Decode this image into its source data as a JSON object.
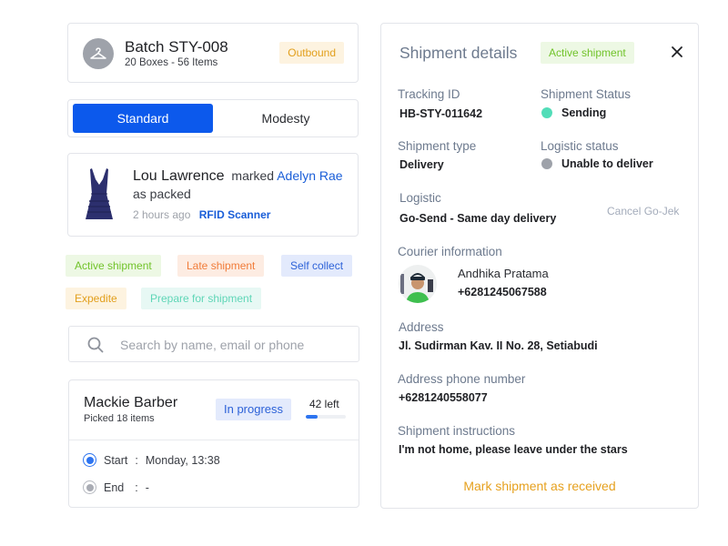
{
  "batch": {
    "icon": "hanger-icon",
    "title": "Batch STY-008",
    "subtitle": "20 Boxes - 56 Items",
    "badge": "Outbound"
  },
  "segmented": {
    "options": [
      "Standard",
      "Modesty"
    ],
    "selected": "Standard"
  },
  "activity": {
    "image": "dress-image",
    "actor": "Lou Lawrence",
    "verb": "marked",
    "target": "Adelyn Rae",
    "result": "as packed",
    "time": "2 hours ago",
    "source": "RFID Scanner"
  },
  "tags": [
    {
      "label": "Active shipment",
      "color": "#71c32a",
      "bg": "#edf8e4"
    },
    {
      "label": "Late shipment",
      "color": "#f17c39",
      "bg": "#fdece2"
    },
    {
      "label": "Self collect",
      "color": "#2d62d8",
      "bg": "#e3eafc"
    },
    {
      "label": "Expedite",
      "color": "#e29f1c",
      "bg": "#fdf3e0"
    },
    {
      "label": "Prepare for shipment",
      "color": "#5fd6b7",
      "bg": "#e7f8f4"
    }
  ],
  "search": {
    "placeholder": "Search by name, email or phone",
    "value": ""
  },
  "picker": {
    "name": "Mackie Barber",
    "subtitle": "Picked 18 items",
    "status": "In progress",
    "left_label": "42 left",
    "progress_fraction": 0.3,
    "start_label": "Start",
    "start_value": "Monday, 13:38",
    "end_label": "End",
    "end_value": "-",
    "separator": ":"
  },
  "details": {
    "title": "Shipment details",
    "badge": "Active shipment",
    "tracking_label": "Tracking ID",
    "tracking_value": "HB-STY-011642",
    "status_label": "Shipment Status",
    "status_value": "Sending",
    "status_color": "#52ddb8",
    "type_label": "Shipment type",
    "type_value": "Delivery",
    "logistic_status_label": "Logistic status",
    "logistic_status_value": "Unable to deliver",
    "logistic_status_color": "#9ea2aa",
    "logistic_label": "Logistic",
    "logistic_value": "Go-Send - Same day delivery",
    "cancel_label": "Cancel Go-Jek",
    "courier_label": "Courier information",
    "courier_name": "Andhika Pratama",
    "courier_phone": "+6281245067588",
    "address_label": "Address",
    "address_value": "Jl. Sudirman Kav. II No. 28, Setiabudi",
    "address_phone_label": "Address phone number",
    "address_phone_value": "+6281240558077",
    "instructions_label": "Shipment instructions",
    "instructions_value": "I'm not home, please leave under the stars",
    "action_label": "Mark shipment as received"
  },
  "colors": {
    "primary": "#0c59ec",
    "link": "#1a5ed8",
    "accent_orange": "#e6a11f"
  }
}
